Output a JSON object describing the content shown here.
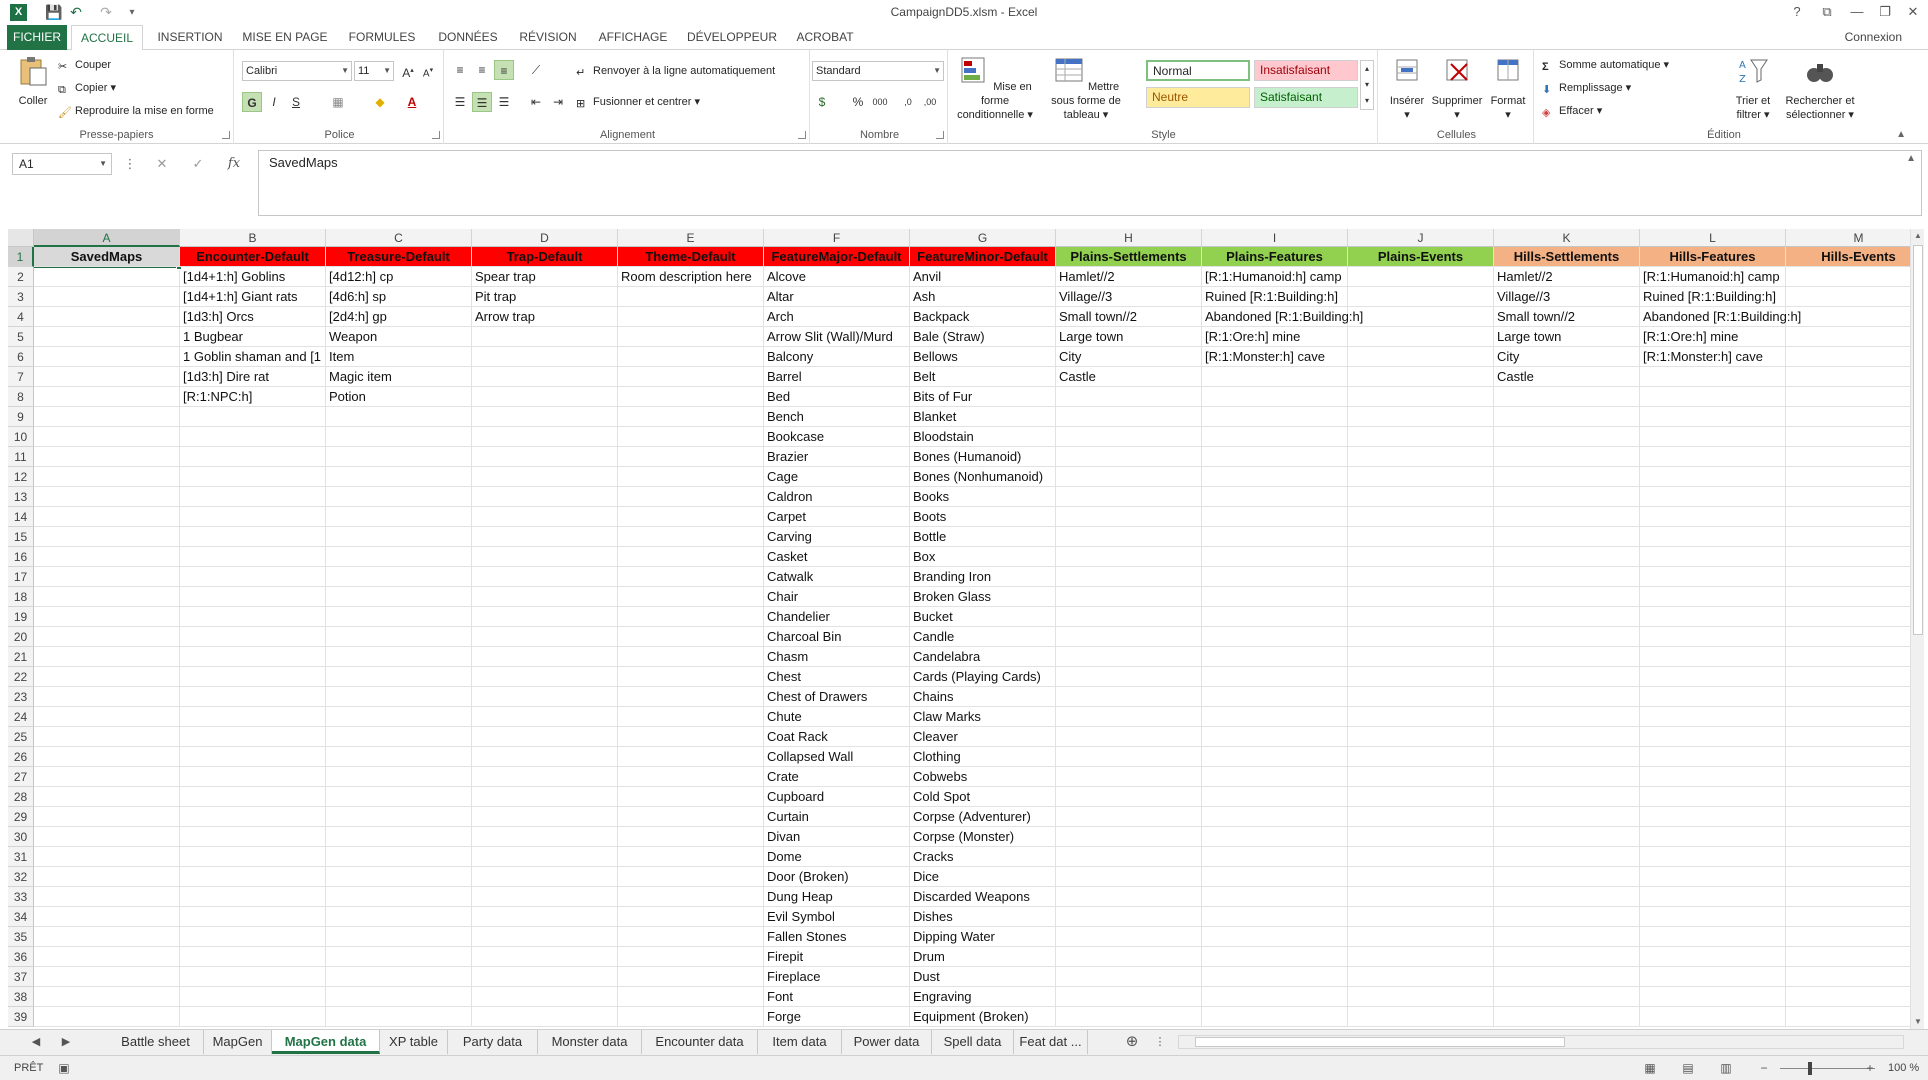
{
  "window": {
    "title": "CampaignDD5.xlsm - Excel",
    "app_icon": "X",
    "controls": [
      "?",
      "⧉",
      "—",
      "❐",
      "✕"
    ]
  },
  "ribbon": {
    "tabs": [
      "FICHIER",
      "ACCUEIL",
      "INSERTION",
      "MISE EN PAGE",
      "FORMULES",
      "DONNÉES",
      "RÉVISION",
      "AFFICHAGE",
      "DÉVELOPPEUR",
      "ACROBAT"
    ],
    "active_tab": "ACCUEIL",
    "account": "Connexion",
    "clipboard": {
      "label": "Presse-papiers",
      "paste": "Coller",
      "cut": "Couper",
      "copy": "Copier",
      "format_painter": "Reproduire la mise en forme"
    },
    "font": {
      "label": "Police",
      "name": "Calibri",
      "size": "11",
      "bold": "G",
      "italic": "I",
      "underline": "S"
    },
    "alignment": {
      "label": "Alignement",
      "wrap": "Renvoyer à la ligne automatiquement",
      "merge": "Fusionner et centrer"
    },
    "number": {
      "label": "Nombre",
      "format": "Standard",
      "percent": "%",
      "thousands": "000"
    },
    "styles": {
      "label": "Style",
      "conditional": "Mise en forme conditionnelle",
      "as_table": "Mettre sous forme de tableau",
      "normal": "Normal",
      "bad": "Insatisfaisant",
      "neutral": "Neutre",
      "good": "Satisfaisant"
    },
    "cells": {
      "label": "Cellules",
      "insert": "Insérer",
      "delete": "Supprimer",
      "format": "Format"
    },
    "editing": {
      "label": "Édition",
      "autosum": "Somme automatique",
      "fill": "Remplissage",
      "clear": "Effacer",
      "sort": "Trier et filtrer",
      "find": "Rechercher et sélectionner"
    }
  },
  "formula_bar": {
    "name_box": "A1",
    "formula": "SavedMaps",
    "fx": "fx"
  },
  "grid": {
    "columns": [
      "A",
      "B",
      "C",
      "D",
      "E",
      "F",
      "G",
      "H",
      "I",
      "J",
      "K",
      "L",
      "M"
    ],
    "row_count": 39,
    "selected_cell": "A1",
    "header_row": [
      "SavedMaps",
      "Encounter-Default",
      "Treasure-Default",
      "Trap-Default",
      "Theme-Default",
      "FeatureMajor-Default",
      "FeatureMinor-Default",
      "Plains-Settlements",
      "Plains-Features",
      "Plains-Events",
      "Hills-Settlements",
      "Hills-Features",
      "Hills-Events"
    ],
    "header_colors": {
      "A": "#d9d9d9",
      "red": "#ff0000",
      "green": "#92d050",
      "orange": "#f4b183"
    },
    "columns_data": {
      "B": [
        "[1d4+1:h] Goblins",
        "[1d4+1:h] Giant rats",
        "[1d3:h] Orcs",
        "1 Bugbear",
        "1 Goblin shaman and [1",
        "[1d3:h] Dire rat",
        "[R:1:NPC:h]"
      ],
      "C": [
        "[4d12:h] cp",
        "[4d6:h] sp",
        "[2d4:h] gp",
        "Weapon",
        "Item",
        "Magic item",
        "Potion"
      ],
      "D": [
        "Spear trap",
        "Pit trap",
        "Arrow trap"
      ],
      "E": [
        "Room description here"
      ],
      "F": [
        "Alcove",
        "Altar",
        "Arch",
        "Arrow Slit (Wall)/Murd",
        "Balcony",
        "Barrel",
        "Bed",
        "Bench",
        "Bookcase",
        "Brazier",
        "Cage",
        "Caldron",
        "Carpet",
        "Carving",
        "Casket",
        "Catwalk",
        "Chair",
        "Chandelier",
        "Charcoal Bin",
        "Chasm",
        "Chest",
        "Chest of Drawers",
        "Chute",
        "Coat Rack",
        "Collapsed Wall",
        "Crate",
        "Cupboard",
        "Curtain",
        "Divan",
        "Dome",
        "Door (Broken)",
        "Dung Heap",
        "Evil Symbol",
        "Fallen Stones",
        "Firepit",
        "Fireplace",
        "Font",
        "Forge"
      ],
      "G": [
        "Anvil",
        "Ash",
        "Backpack",
        "Bale (Straw)",
        "Bellows",
        "Belt",
        "Bits of Fur",
        "Blanket",
        "Bloodstain",
        "Bones (Humanoid)",
        "Bones (Nonhumanoid)",
        "Books",
        "Boots",
        "Bottle",
        "Box",
        "Branding Iron",
        "Broken Glass",
        "Bucket",
        "Candle",
        "Candelabra",
        "Cards (Playing Cards)",
        "Chains",
        "Claw Marks",
        "Cleaver",
        "Clothing",
        "Cobwebs",
        "Cold Spot",
        "Corpse (Adventurer)",
        "Corpse (Monster)",
        "Cracks",
        "Dice",
        "Discarded Weapons",
        "Dishes",
        "Dipping Water",
        "Drum",
        "Dust",
        "Engraving",
        "Equipment (Broken)"
      ],
      "H": [
        "Hamlet//2",
        "Village//3",
        "Small town//2",
        "Large town",
        "City",
        "Castle"
      ],
      "I": [
        "[R:1:Humanoid:h] camp",
        "Ruined  [R:1:Building:h]",
        "Abandoned [R:1:Building:h]",
        "[R:1:Ore:h] mine",
        "[R:1:Monster:h] cave"
      ],
      "K": [
        "Hamlet//2",
        "Village//3",
        "Small town//2",
        "Large town",
        "City",
        "Castle"
      ],
      "L": [
        "[R:1:Humanoid:h] camp",
        "Ruined  [R:1:Building:h]",
        "Abandoned [R:1:Building:h]",
        "[R:1:Ore:h] mine",
        "[R:1:Monster:h] cave"
      ]
    }
  },
  "sheet_tabs": {
    "tabs": [
      "Battle sheet",
      "MapGen",
      "MapGen data",
      "XP table",
      "Party data",
      "Monster data",
      "Encounter data",
      "Item data",
      "Power data",
      "Spell data",
      "Feat dat ..."
    ],
    "active": "MapGen data"
  },
  "status_bar": {
    "status": "PRÊT",
    "zoom": "100 %"
  }
}
